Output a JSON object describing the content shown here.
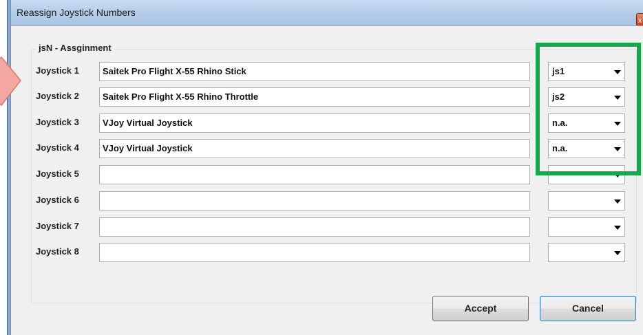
{
  "window": {
    "title": "Reassign Joystick Numbers",
    "close_icon": "close-icon"
  },
  "group": {
    "label": "jsN - Assginment"
  },
  "rows": [
    {
      "label": "Joystick 1",
      "device": "Saitek Pro Flight X-55 Rhino Stick",
      "assignment": "js1"
    },
    {
      "label": "Joystick 2",
      "device": "Saitek Pro Flight X-55 Rhino Throttle",
      "assignment": "js2"
    },
    {
      "label": "Joystick 3",
      "device": "VJoy Virtual Joystick",
      "assignment": "n.a."
    },
    {
      "label": "Joystick 4",
      "device": "VJoy Virtual Joystick",
      "assignment": "n.a."
    },
    {
      "label": "Joystick 5",
      "device": "",
      "assignment": ""
    },
    {
      "label": "Joystick 6",
      "device": "",
      "assignment": ""
    },
    {
      "label": "Joystick 7",
      "device": "",
      "assignment": ""
    },
    {
      "label": "Joystick 8",
      "device": "",
      "assignment": ""
    }
  ],
  "buttons": {
    "accept": "Accept",
    "cancel": "Cancel"
  },
  "colors": {
    "highlight": "#14a94a",
    "pointer": "#f4a6a0"
  }
}
